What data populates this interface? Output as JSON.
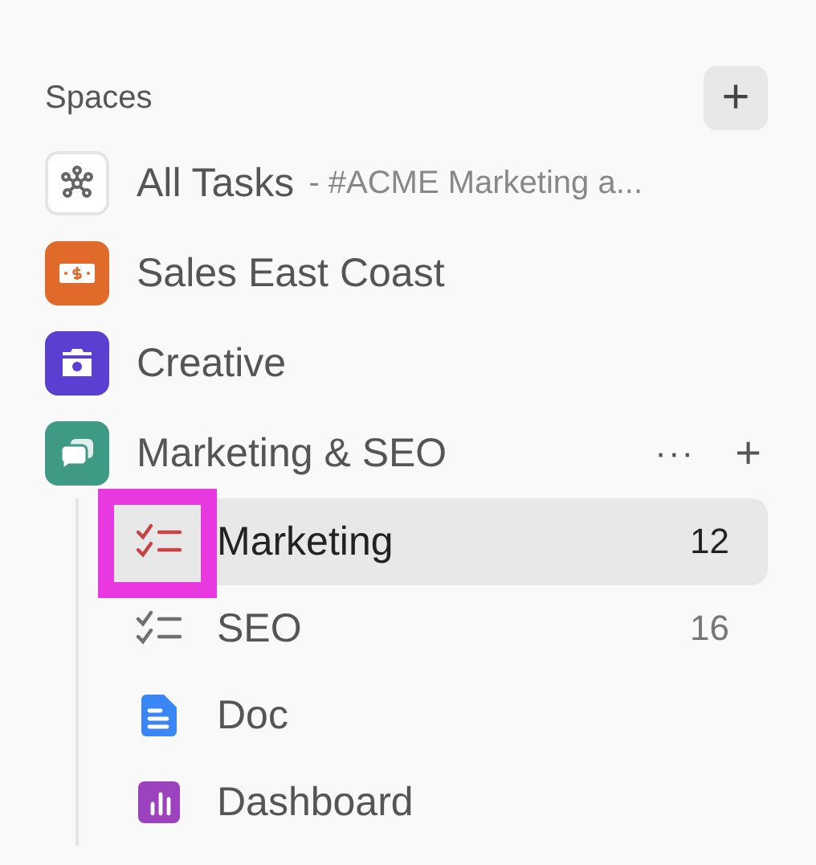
{
  "header": {
    "title": "Spaces",
    "add_button": "+"
  },
  "spaces": [
    {
      "kind": "all",
      "name": "All Tasks",
      "subtitle": "- #ACME Marketing a...",
      "color": "#ffffff"
    },
    {
      "kind": "sales",
      "name": "Sales East Coast",
      "color": "#e06a2a"
    },
    {
      "kind": "creative",
      "name": "Creative",
      "color": "#5b3fd0"
    },
    {
      "kind": "chat",
      "name": "Marketing & SEO",
      "color": "#3f9a85",
      "more": "···",
      "add": "+",
      "expanded": true
    }
  ],
  "children": [
    {
      "kind": "list",
      "name": "Marketing",
      "count": "12",
      "color": "#c84444",
      "selected": true,
      "highlighted": true
    },
    {
      "kind": "list",
      "name": "SEO",
      "count": "16",
      "color": "#707070",
      "selected": false,
      "highlighted": false
    },
    {
      "kind": "doc",
      "name": "Doc",
      "color": "#3b86f5",
      "selected": false,
      "highlighted": false
    },
    {
      "kind": "dashboard",
      "name": "Dashboard",
      "color": "#9c42bf",
      "selected": false,
      "highlighted": false
    }
  ]
}
